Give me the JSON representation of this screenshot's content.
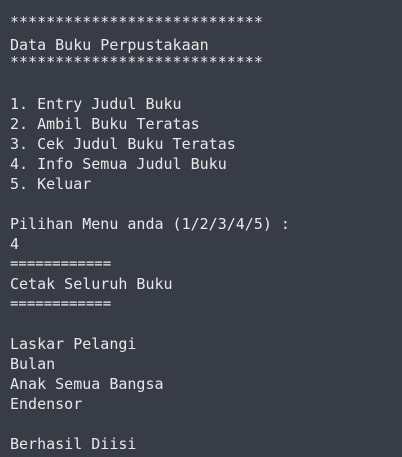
{
  "terminal": {
    "header": {
      "border_top": "****************************",
      "title": "Data Buku Perpustakaan",
      "border_bottom": "****************************"
    },
    "menu": {
      "items": [
        "1. Entry Judul Buku",
        "2. Ambil Buku Teratas",
        "3. Cek Judul Buku Teratas",
        "4. Info Semua Judul Buku",
        "5. Keluar"
      ],
      "prompt": "Pilihan Menu anda (1/2/3/4/5) :",
      "input_value": "4"
    },
    "print_section": {
      "separator_top": "============",
      "title": "Cetak Seluruh Buku",
      "separator_bottom": "============",
      "books": [
        "Laskar Pelangi",
        "Bulan",
        "Anak Semua Bangsa",
        "Endensor"
      ]
    },
    "status": "Berhasil Diisi"
  }
}
